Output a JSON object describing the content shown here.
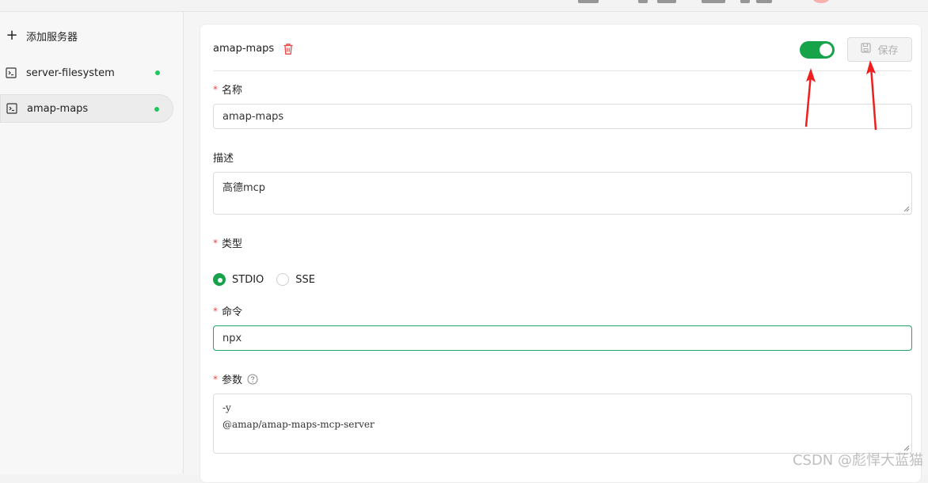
{
  "sidebar": {
    "add_label": "添加服务器",
    "items": [
      {
        "label": "server-filesystem",
        "icon": "terminal-icon",
        "status_color": "#22c55e",
        "active": false
      },
      {
        "label": "amap-maps",
        "icon": "terminal-icon",
        "status_color": "#22c55e",
        "active": true
      }
    ]
  },
  "detail": {
    "title": "amap-maps",
    "enabled": true,
    "save_label": "保存",
    "fields": {
      "name": {
        "label": "名称",
        "required": true,
        "value": "amap-maps"
      },
      "description": {
        "label": "描述",
        "required": false,
        "value": "高德mcp"
      },
      "type": {
        "label": "类型",
        "required": true,
        "options": [
          "STDIO",
          "SSE"
        ],
        "selected": "STDIO"
      },
      "command": {
        "label": "命令",
        "required": true,
        "value": "npx"
      },
      "args": {
        "label": "参数",
        "required": true,
        "lines": [
          "-y",
          "@amap/amap-maps-mcp-server"
        ]
      }
    }
  },
  "watermark": "CSDN @彪悍大蓝猫",
  "colors": {
    "accent": "#16a34a",
    "required": "#ef4444",
    "annotation_arrow": "#ef1f1f"
  }
}
